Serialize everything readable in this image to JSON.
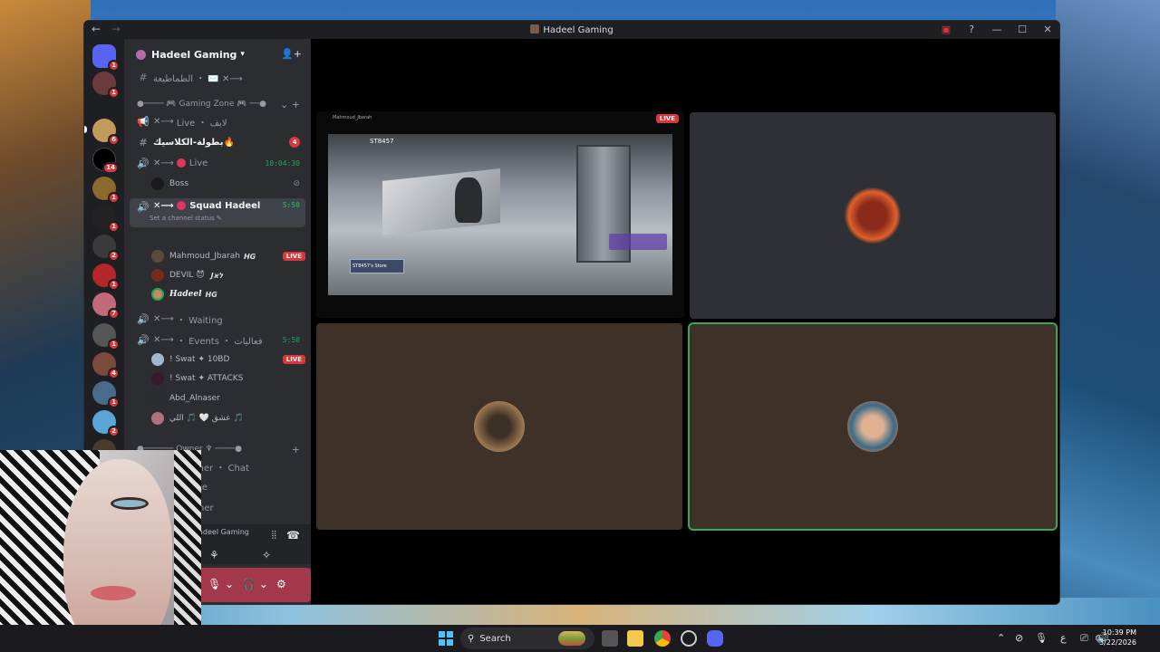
{
  "window": {
    "title": "Hadeel Gaming",
    "nav_back": "←",
    "nav_forward": "→"
  },
  "server": {
    "name": "Hadeel Gaming",
    "rail_badges": [
      "1",
      "1",
      "6",
      "14",
      "1",
      "1",
      "2",
      "1",
      "7",
      "1",
      "4",
      "1",
      "2",
      "1"
    ]
  },
  "channels": {
    "top_channel": "الطماطيعة ・ ✉️ ✕⟶",
    "category_gaming": "Gaming Zone",
    "live_text": "Live ・ لايف",
    "bttola": "بطولة-الكلاسيك",
    "bttola_count": "4",
    "live_voice": "Live",
    "live_voice_time": "10:04:30",
    "boss": "Boss",
    "squad": "Squad Hadeel",
    "squad_time": "5:50",
    "squad_status": "Set a channel status",
    "waiting": "・ Waiting",
    "events": "・ Events ・ فعاليات",
    "events_time": "5:50",
    "category_owner": "Owner",
    "owner_chat": "・ Owner ・ Chat",
    "partial1": "te",
    "partial2": "ner"
  },
  "squad_users": [
    {
      "name": "Mahmoud_Jbarah",
      "tag": "HG",
      "live": "LIVE"
    },
    {
      "name": "DEVIL",
      "tag": "Jלא"
    },
    {
      "name": "Hadeel",
      "tag": "HG"
    }
  ],
  "event_users": [
    {
      "name": "! Swat ✦ 10BD",
      "live": "LIVE"
    },
    {
      "name": "! Swat ✦ ATTACKS"
    },
    {
      "name": "Abd_Alnaser"
    },
    {
      "name": "عشق 🤍 🎵 اللي 🎵"
    }
  ],
  "voice_panel": {
    "server_label": "adeel Gaming"
  },
  "stream": {
    "live_label": "LIVE",
    "header": "Mahmoud_Jbarah",
    "hud": "ST8457",
    "sign": "ST8457's Store"
  },
  "taskbar": {
    "search_placeholder": "Search",
    "time": "10:39 PM",
    "date": "3/22/2026",
    "lang": "ع"
  },
  "colors": {
    "accent_green": "#23a55a",
    "live_red": "#da373c",
    "user_bar": "#a3384a"
  }
}
